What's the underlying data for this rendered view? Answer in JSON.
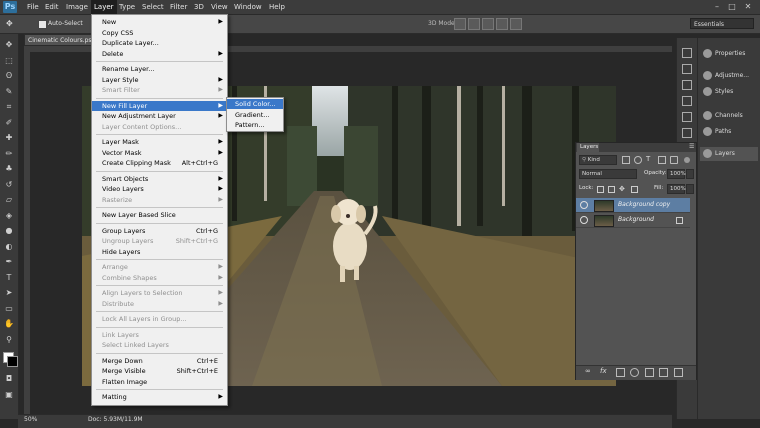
{
  "menubar": {
    "logo": "Ps",
    "items": [
      "File",
      "Edit",
      "Image",
      "Layer",
      "Type",
      "Select",
      "Filter",
      "3D",
      "View",
      "Window",
      "Help"
    ],
    "active_index": 3
  },
  "options_bar": {
    "auto_select": "Auto-Select",
    "mode_3d": "3D Mode:",
    "workspace": "Essentials"
  },
  "document": {
    "tab": "Cinematic Colours.psd",
    "zoom": "50%",
    "doc_info": "Doc: 5.93M/11.9M"
  },
  "layer_menu": {
    "items": [
      {
        "label": "New",
        "arrow": true
      },
      {
        "label": "Copy CSS"
      },
      {
        "label": "Duplicate Layer..."
      },
      {
        "label": "Delete",
        "arrow": true
      },
      {
        "sep": true
      },
      {
        "label": "Rename Layer..."
      },
      {
        "label": "Layer Style",
        "arrow": true
      },
      {
        "label": "Smart Filter",
        "arrow": true,
        "disabled": true
      },
      {
        "sep": true
      },
      {
        "label": "New Fill Layer",
        "arrow": true,
        "highlight": true
      },
      {
        "label": "New Adjustment Layer",
        "arrow": true
      },
      {
        "label": "Layer Content Options...",
        "disabled": true
      },
      {
        "sep": true
      },
      {
        "label": "Layer Mask",
        "arrow": true
      },
      {
        "label": "Vector Mask",
        "arrow": true
      },
      {
        "label": "Create Clipping Mask",
        "shortcut": "Alt+Ctrl+G"
      },
      {
        "sep": true
      },
      {
        "label": "Smart Objects",
        "arrow": true
      },
      {
        "label": "Video Layers",
        "arrow": true
      },
      {
        "label": "Rasterize",
        "arrow": true,
        "disabled": true
      },
      {
        "sep": true
      },
      {
        "label": "New Layer Based Slice"
      },
      {
        "sep": true
      },
      {
        "label": "Group Layers",
        "shortcut": "Ctrl+G"
      },
      {
        "label": "Ungroup Layers",
        "shortcut": "Shift+Ctrl+G",
        "disabled": true
      },
      {
        "label": "Hide Layers"
      },
      {
        "sep": true
      },
      {
        "label": "Arrange",
        "arrow": true,
        "disabled": true
      },
      {
        "label": "Combine Shapes",
        "arrow": true,
        "disabled": true
      },
      {
        "sep": true
      },
      {
        "label": "Align Layers to Selection",
        "arrow": true,
        "disabled": true
      },
      {
        "label": "Distribute",
        "arrow": true,
        "disabled": true
      },
      {
        "sep": true
      },
      {
        "label": "Lock All Layers in Group...",
        "disabled": true
      },
      {
        "sep": true
      },
      {
        "label": "Link Layers",
        "disabled": true
      },
      {
        "label": "Select Linked Layers",
        "disabled": true
      },
      {
        "sep": true
      },
      {
        "label": "Merge Down",
        "shortcut": "Ctrl+E"
      },
      {
        "label": "Merge Visible",
        "shortcut": "Shift+Ctrl+E"
      },
      {
        "label": "Flatten Image"
      },
      {
        "sep": true
      },
      {
        "label": "Matting",
        "arrow": true
      }
    ]
  },
  "fill_submenu": {
    "items": [
      {
        "label": "Solid Color...",
        "highlight": true
      },
      {
        "label": "Gradient..."
      },
      {
        "label": "Pattern..."
      }
    ]
  },
  "right_dock": {
    "items": [
      "Properties",
      "Adjustme...",
      "Styles",
      "Channels",
      "Paths",
      "Layers"
    ],
    "selected_index": 5
  },
  "layers_panel": {
    "tab": "Layers",
    "filter_kind": "Kind",
    "blend_mode": "Normal",
    "opacity_label": "Opacity:",
    "opacity_value": "100%",
    "lock_label": "Lock:",
    "fill_label": "Fill:",
    "fill_value": "100%",
    "layers": [
      {
        "name": "Background copy",
        "selected": true
      },
      {
        "name": "Background",
        "selected": false
      }
    ]
  }
}
